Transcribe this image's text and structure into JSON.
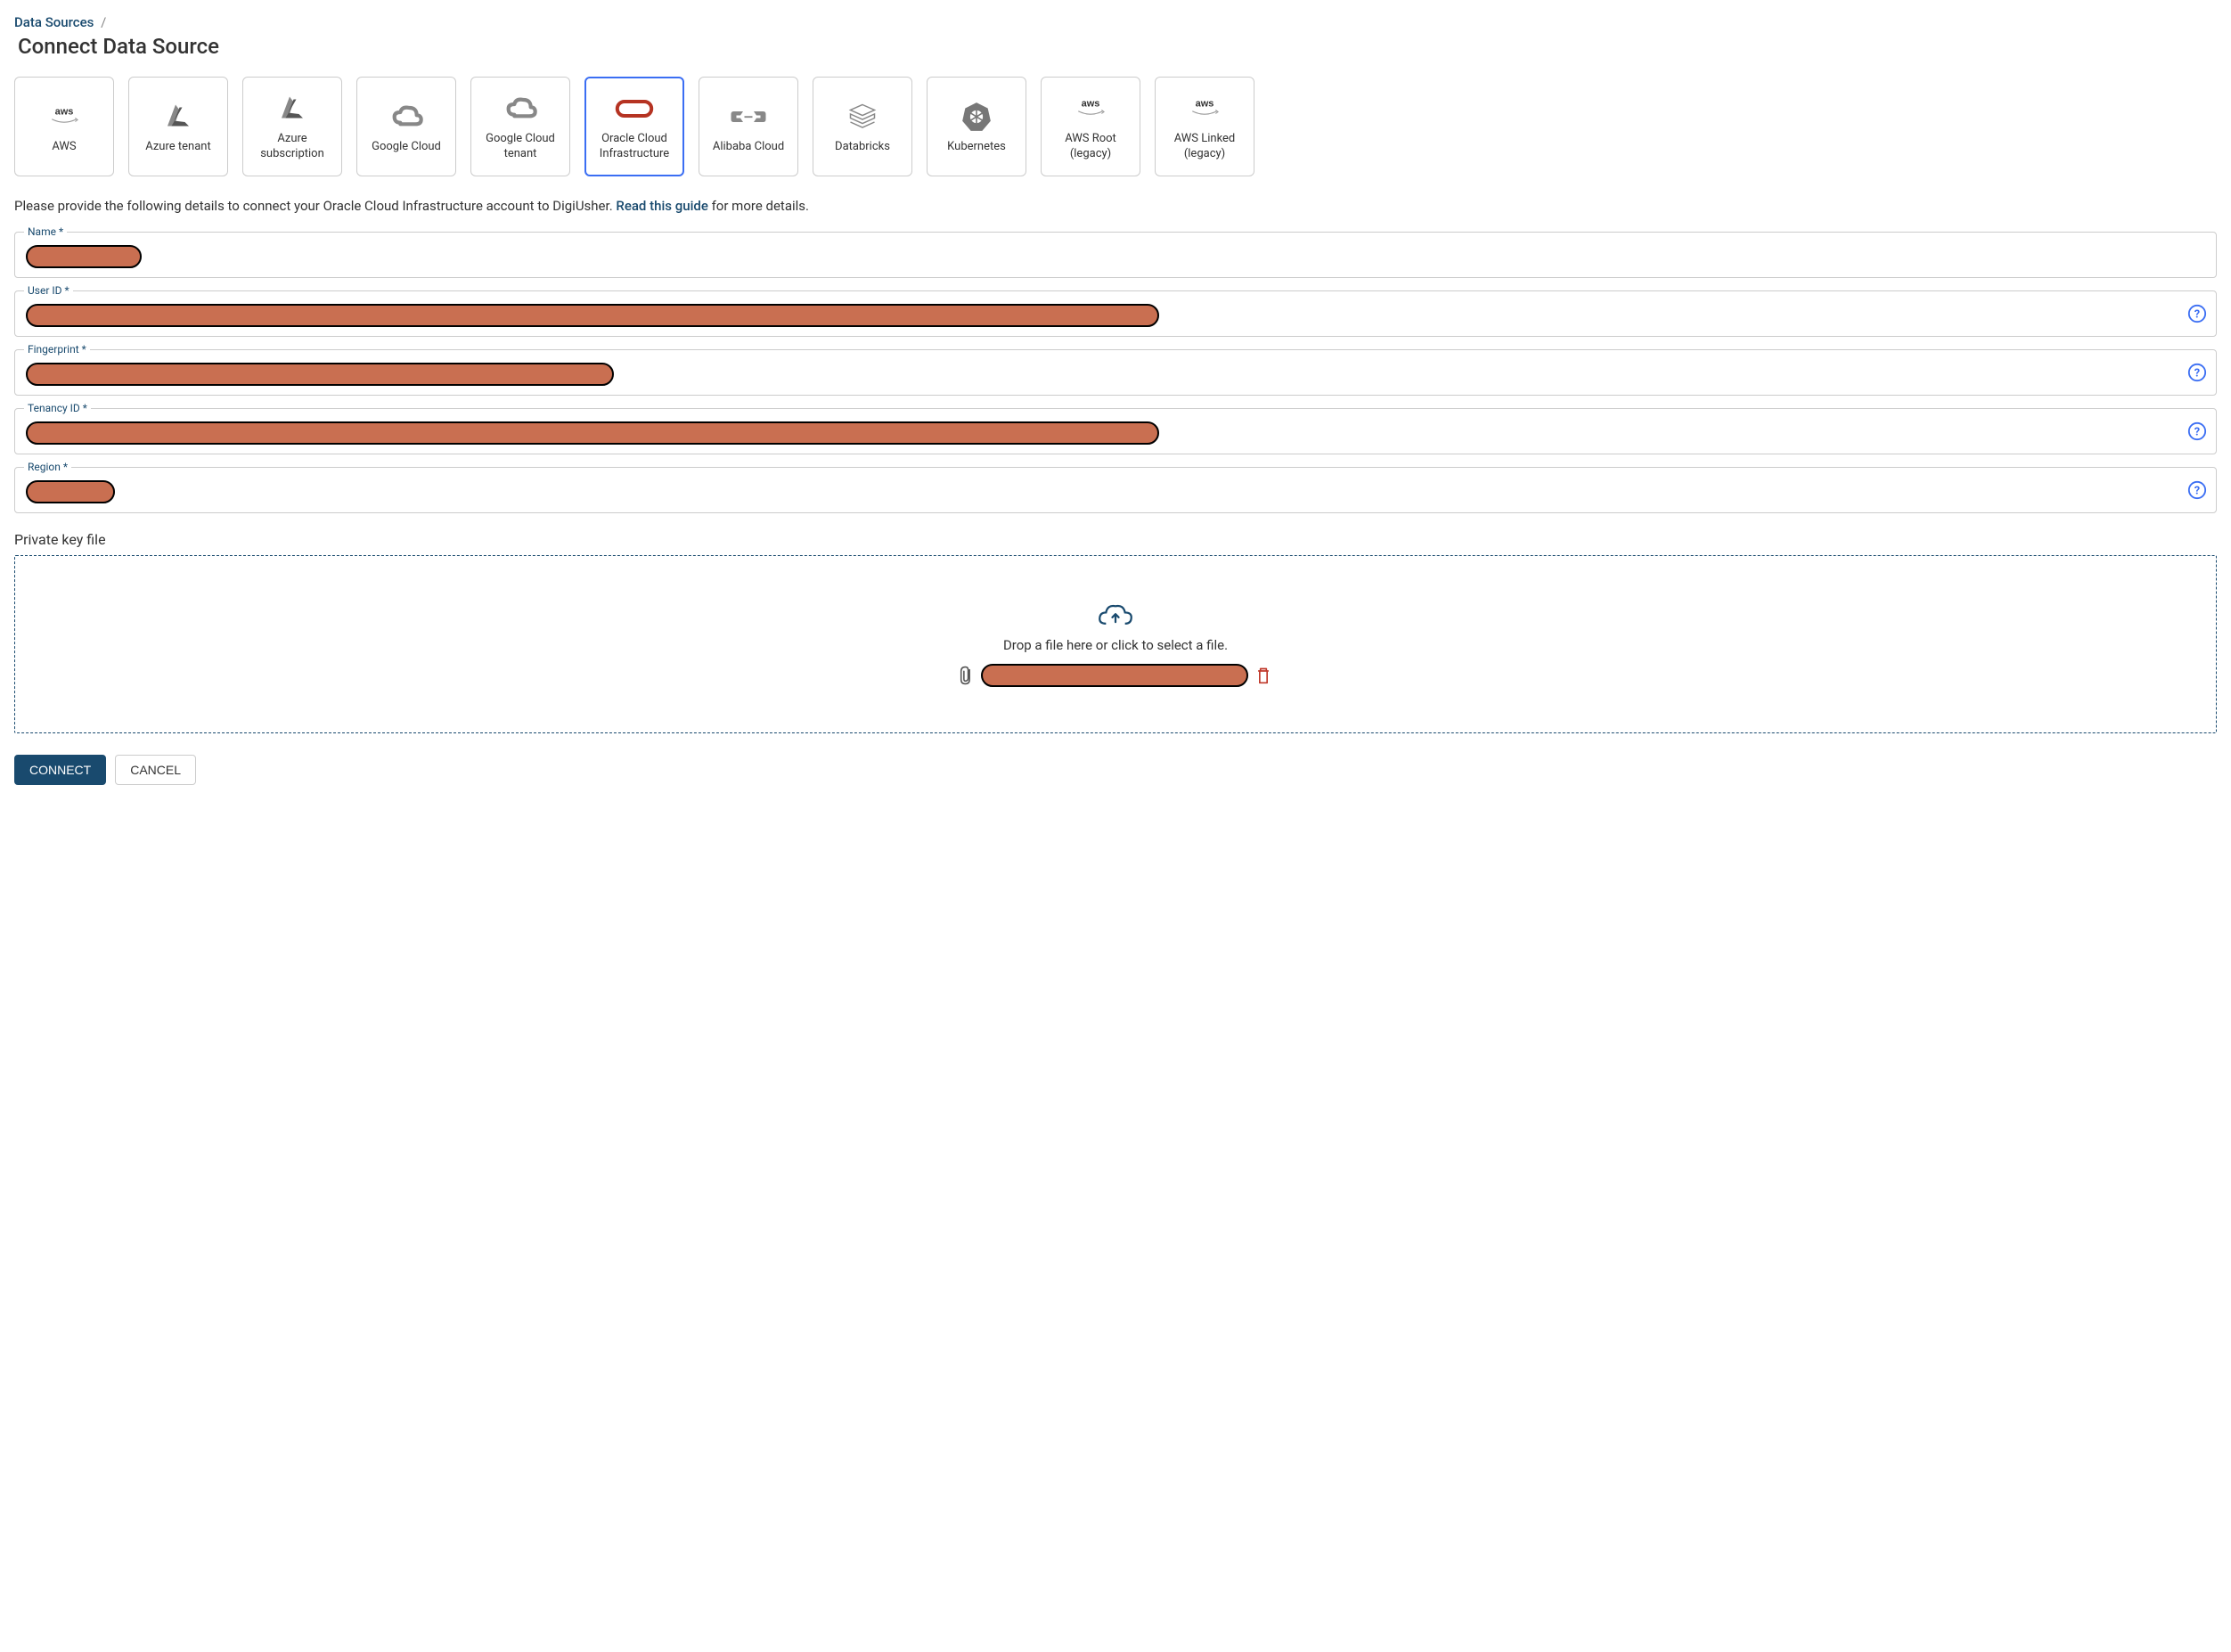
{
  "breadcrumb": {
    "root": "Data Sources",
    "sep": "/"
  },
  "page_title": "Connect Data Source",
  "tiles": [
    {
      "id": "aws",
      "label": "AWS",
      "selected": false
    },
    {
      "id": "azure-tenant",
      "label": "Azure tenant",
      "selected": false
    },
    {
      "id": "azure-subscription",
      "label": "Azure subscription",
      "selected": false
    },
    {
      "id": "google-cloud",
      "label": "Google Cloud",
      "selected": false
    },
    {
      "id": "google-cloud-tenant",
      "label": "Google Cloud tenant",
      "selected": false
    },
    {
      "id": "oci",
      "label": "Oracle Cloud Infrastructure",
      "selected": true
    },
    {
      "id": "alibaba",
      "label": "Alibaba Cloud",
      "selected": false
    },
    {
      "id": "databricks",
      "label": "Databricks",
      "selected": false
    },
    {
      "id": "kubernetes",
      "label": "Kubernetes",
      "selected": false
    },
    {
      "id": "aws-root-legacy",
      "label": "AWS Root (legacy)",
      "selected": false
    },
    {
      "id": "aws-linked-legacy",
      "label": "AWS Linked (legacy)",
      "selected": false
    }
  ],
  "intro": {
    "prefix": "Please provide the following details to connect your Oracle Cloud Infrastructure account to DigiUsher. ",
    "link": "Read this guide",
    "suffix": " for more details."
  },
  "fields": {
    "name": {
      "label": "Name *"
    },
    "user_id": {
      "label": "User ID *"
    },
    "fingerprint": {
      "label": "Fingerprint *"
    },
    "tenancy_id": {
      "label": "Tenancy ID *"
    },
    "region": {
      "label": "Region *"
    }
  },
  "private_key": {
    "section_label": "Private key file",
    "drop_text": "Drop a file here or click to select a file."
  },
  "buttons": {
    "connect": "CONNECT",
    "cancel": "CANCEL"
  }
}
